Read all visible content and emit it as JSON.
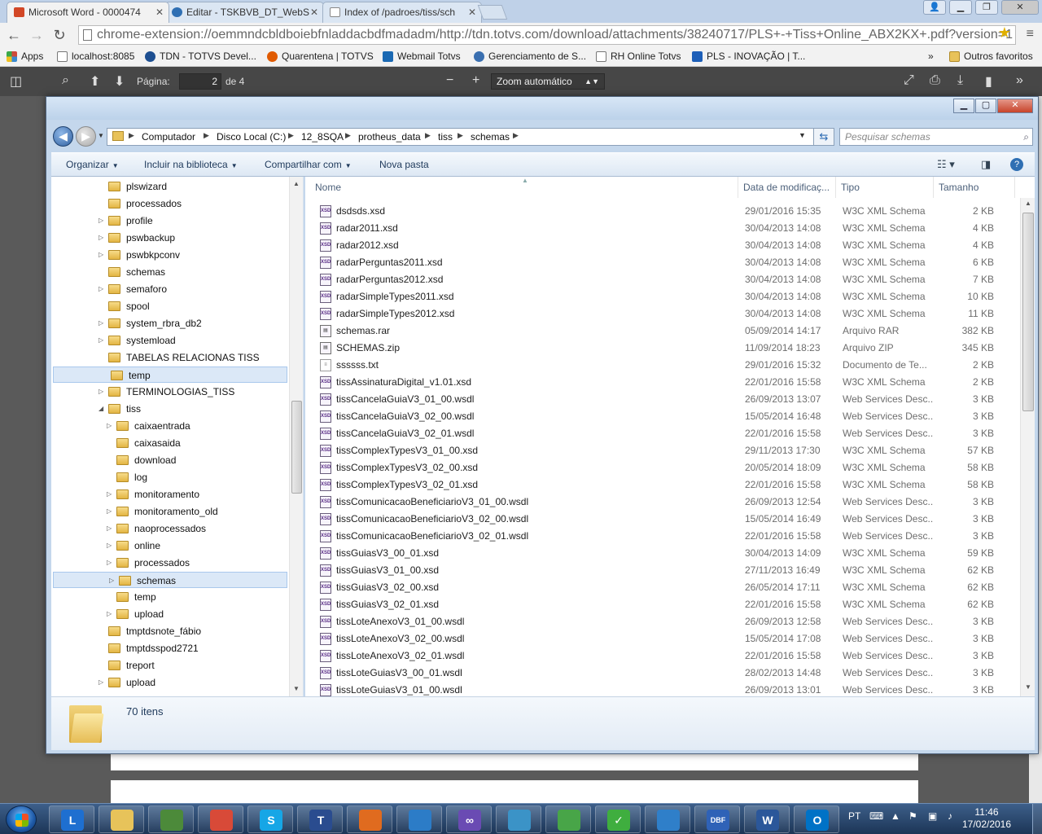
{
  "browser": {
    "tabs": [
      {
        "label": "Microsoft Word - 0000474",
        "icon": "office-icon",
        "color": "#d24726",
        "active": true
      },
      {
        "label": "Editar - TSKBVB_DT_WebS",
        "icon": "confluence-icon",
        "color": "#2f6fb3",
        "active": false
      },
      {
        "label": "Index of /padroes/tiss/sch",
        "icon": "page-icon",
        "color": "#9a9a9a",
        "active": false
      }
    ],
    "url": "chrome-extension://oemmndcbldboiebfnladdacbdfmadadm/http://tdn.totvs.com/download/attachments/38240717/PLS+-+Tiss+Online_ABX2KX+.pdf?version=1",
    "bookmarks": [
      {
        "label": "Apps",
        "icon": "apps-icon",
        "color": "#d04a3a"
      },
      {
        "label": "localhost:8085",
        "icon": "page-icon",
        "color": "#ffffff"
      },
      {
        "label": "TDN - TOTVS Devel...",
        "icon": "totvs-icon",
        "color": "#1d4f91"
      },
      {
        "label": "Quarentena | TOTVS",
        "icon": "totvs-icon",
        "color": "#e05a00"
      },
      {
        "label": "Webmail Totvs",
        "icon": "mail-icon",
        "color": "#1b69b3"
      },
      {
        "label": "Gerenciamento de S...",
        "icon": "globe-icon",
        "color": "#3a6fb0"
      },
      {
        "label": "RH Online Totvs",
        "icon": "page-icon",
        "color": "#ffffff"
      },
      {
        "label": "PLS - INOVAÇÃO | T...",
        "icon": "jira-icon",
        "color": "#1d5fb8"
      }
    ],
    "bookmarks_overflow": "»",
    "other_bookmarks": "Outros favoritos"
  },
  "pdf_toolbar": {
    "page_label": "Página:",
    "page_value": "2",
    "page_total": "de 4",
    "zoom": "Zoom automático",
    "zoom_out": "−",
    "zoom_in": "+"
  },
  "explorer": {
    "breadcrumb": [
      "Computador",
      "Disco Local (C:)",
      "12_8SQA",
      "protheus_data",
      "tiss",
      "schemas"
    ],
    "search_placeholder": "Pesquisar schemas",
    "commands": {
      "organize": "Organizar",
      "include": "Incluir na biblioteca",
      "share": "Compartilhar com",
      "new_folder": "Nova pasta"
    },
    "nav_tree": [
      {
        "label": "plswizard",
        "level": 0,
        "expandable": false,
        "selected": false
      },
      {
        "label": "processados",
        "level": 0,
        "expandable": false,
        "selected": false
      },
      {
        "label": "profile",
        "level": 0,
        "expandable": true,
        "selected": false
      },
      {
        "label": "pswbackup",
        "level": 0,
        "expandable": true,
        "selected": false
      },
      {
        "label": "pswbkpconv",
        "level": 0,
        "expandable": true,
        "selected": false
      },
      {
        "label": "schemas",
        "level": 0,
        "expandable": false,
        "selected": false
      },
      {
        "label": "semaforo",
        "level": 0,
        "expandable": true,
        "selected": false
      },
      {
        "label": "spool",
        "level": 0,
        "expandable": false,
        "selected": false
      },
      {
        "label": "system_rbra_db2",
        "level": 0,
        "expandable": true,
        "selected": false
      },
      {
        "label": "systemload",
        "level": 0,
        "expandable": true,
        "selected": false
      },
      {
        "label": "TABELAS RELACIONAS TISS",
        "level": 0,
        "expandable": false,
        "selected": false
      },
      {
        "label": "temp",
        "level": 0,
        "expandable": false,
        "selected": true
      },
      {
        "label": "TERMINOLOGIAS_TISS",
        "level": 0,
        "expandable": true,
        "selected": false
      },
      {
        "label": "tiss",
        "level": 0,
        "expandable": true,
        "expanded": true,
        "selected": false
      },
      {
        "label": "caixaentrada",
        "level": 1,
        "expandable": true,
        "selected": false
      },
      {
        "label": "caixasaida",
        "level": 1,
        "expandable": false,
        "selected": false
      },
      {
        "label": "download",
        "level": 1,
        "expandable": false,
        "selected": false
      },
      {
        "label": "log",
        "level": 1,
        "expandable": false,
        "selected": false
      },
      {
        "label": "monitoramento",
        "level": 1,
        "expandable": true,
        "selected": false
      },
      {
        "label": "monitoramento_old",
        "level": 1,
        "expandable": true,
        "selected": false
      },
      {
        "label": "naoprocessados",
        "level": 1,
        "expandable": true,
        "selected": false
      },
      {
        "label": "online",
        "level": 1,
        "expandable": true,
        "selected": false
      },
      {
        "label": "processados",
        "level": 1,
        "expandable": true,
        "selected": false
      },
      {
        "label": "schemas",
        "level": 1,
        "expandable": true,
        "selected": true
      },
      {
        "label": "temp",
        "level": 1,
        "expandable": false,
        "selected": false
      },
      {
        "label": "upload",
        "level": 1,
        "expandable": true,
        "selected": false
      },
      {
        "label": "tmptdsnote_fábio",
        "level": 0,
        "expandable": false,
        "selected": false
      },
      {
        "label": "tmptdsspod2721",
        "level": 0,
        "expandable": false,
        "selected": false
      },
      {
        "label": "treport",
        "level": 0,
        "expandable": false,
        "selected": false
      },
      {
        "label": "upload",
        "level": 0,
        "expandable": true,
        "selected": false
      }
    ],
    "columns": {
      "name": "Nome",
      "modified": "Data de modificaç...",
      "type": "Tipo",
      "size": "Tamanho"
    },
    "files": [
      {
        "name": "dsdsds.xsd",
        "modified": "29/01/2016 15:35",
        "type": "W3C XML Schema",
        "size": "2 KB",
        "icon": "xsd"
      },
      {
        "name": "radar2011.xsd",
        "modified": "30/04/2013 14:08",
        "type": "W3C XML Schema",
        "size": "4 KB",
        "icon": "xsd"
      },
      {
        "name": "radar2012.xsd",
        "modified": "30/04/2013 14:08",
        "type": "W3C XML Schema",
        "size": "4 KB",
        "icon": "xsd"
      },
      {
        "name": "radarPerguntas2011.xsd",
        "modified": "30/04/2013 14:08",
        "type": "W3C XML Schema",
        "size": "6 KB",
        "icon": "xsd"
      },
      {
        "name": "radarPerguntas2012.xsd",
        "modified": "30/04/2013 14:08",
        "type": "W3C XML Schema",
        "size": "7 KB",
        "icon": "xsd"
      },
      {
        "name": "radarSimpleTypes2011.xsd",
        "modified": "30/04/2013 14:08",
        "type": "W3C XML Schema",
        "size": "10 KB",
        "icon": "xsd"
      },
      {
        "name": "radarSimpleTypes2012.xsd",
        "modified": "30/04/2013 14:08",
        "type": "W3C XML Schema",
        "size": "11 KB",
        "icon": "xsd"
      },
      {
        "name": "schemas.rar",
        "modified": "05/09/2014 14:17",
        "type": "Arquivo RAR",
        "size": "382 KB",
        "icon": "rar"
      },
      {
        "name": "SCHEMAS.zip",
        "modified": "11/09/2014 18:23",
        "type": "Arquivo ZIP",
        "size": "345 KB",
        "icon": "rar"
      },
      {
        "name": "ssssss.txt",
        "modified": "29/01/2016 15:32",
        "type": "Documento de Te...",
        "size": "2 KB",
        "icon": "txt"
      },
      {
        "name": "tissAssinaturaDigital_v1.01.xsd",
        "modified": "22/01/2016 15:58",
        "type": "W3C XML Schema",
        "size": "2 KB",
        "icon": "xsd"
      },
      {
        "name": "tissCancelaGuiaV3_01_00.wsdl",
        "modified": "26/09/2013 13:07",
        "type": "Web Services Desc...",
        "size": "3 KB",
        "icon": "xsd"
      },
      {
        "name": "tissCancelaGuiaV3_02_00.wsdl",
        "modified": "15/05/2014 16:48",
        "type": "Web Services Desc...",
        "size": "3 KB",
        "icon": "xsd"
      },
      {
        "name": "tissCancelaGuiaV3_02_01.wsdl",
        "modified": "22/01/2016 15:58",
        "type": "Web Services Desc...",
        "size": "3 KB",
        "icon": "xsd"
      },
      {
        "name": "tissComplexTypesV3_01_00.xsd",
        "modified": "29/11/2013 17:30",
        "type": "W3C XML Schema",
        "size": "57 KB",
        "icon": "xsd"
      },
      {
        "name": "tissComplexTypesV3_02_00.xsd",
        "modified": "20/05/2014 18:09",
        "type": "W3C XML Schema",
        "size": "58 KB",
        "icon": "xsd"
      },
      {
        "name": "tissComplexTypesV3_02_01.xsd",
        "modified": "22/01/2016 15:58",
        "type": "W3C XML Schema",
        "size": "58 KB",
        "icon": "xsd"
      },
      {
        "name": "tissComunicacaoBeneficiarioV3_01_00.wsdl",
        "modified": "26/09/2013 12:54",
        "type": "Web Services Desc...",
        "size": "3 KB",
        "icon": "xsd"
      },
      {
        "name": "tissComunicacaoBeneficiarioV3_02_00.wsdl",
        "modified": "15/05/2014 16:49",
        "type": "Web Services Desc...",
        "size": "3 KB",
        "icon": "xsd"
      },
      {
        "name": "tissComunicacaoBeneficiarioV3_02_01.wsdl",
        "modified": "22/01/2016 15:58",
        "type": "Web Services Desc...",
        "size": "3 KB",
        "icon": "xsd"
      },
      {
        "name": "tissGuiasV3_00_01.xsd",
        "modified": "30/04/2013 14:09",
        "type": "W3C XML Schema",
        "size": "59 KB",
        "icon": "xsd"
      },
      {
        "name": "tissGuiasV3_01_00.xsd",
        "modified": "27/11/2013 16:49",
        "type": "W3C XML Schema",
        "size": "62 KB",
        "icon": "xsd"
      },
      {
        "name": "tissGuiasV3_02_00.xsd",
        "modified": "26/05/2014 17:11",
        "type": "W3C XML Schema",
        "size": "62 KB",
        "icon": "xsd"
      },
      {
        "name": "tissGuiasV3_02_01.xsd",
        "modified": "22/01/2016 15:58",
        "type": "W3C XML Schema",
        "size": "62 KB",
        "icon": "xsd"
      },
      {
        "name": "tissLoteAnexoV3_01_00.wsdl",
        "modified": "26/09/2013 12:58",
        "type": "Web Services Desc...",
        "size": "3 KB",
        "icon": "xsd"
      },
      {
        "name": "tissLoteAnexoV3_02_00.wsdl",
        "modified": "15/05/2014 17:08",
        "type": "Web Services Desc...",
        "size": "3 KB",
        "icon": "xsd"
      },
      {
        "name": "tissLoteAnexoV3_02_01.wsdl",
        "modified": "22/01/2016 15:58",
        "type": "Web Services Desc...",
        "size": "3 KB",
        "icon": "xsd"
      },
      {
        "name": "tissLoteGuiasV3_00_01.wsdl",
        "modified": "28/02/2013 14:48",
        "type": "Web Services Desc...",
        "size": "3 KB",
        "icon": "xsd"
      },
      {
        "name": "tissLoteGuiasV3_01_00.wsdl",
        "modified": "26/09/2013 13:01",
        "type": "Web Services Desc...",
        "size": "3 KB",
        "icon": "xsd"
      }
    ],
    "item_count": "70 itens"
  },
  "taskbar": {
    "apps": [
      {
        "name": "lync-app",
        "glyph": "L",
        "color": "#1e6fd0"
      },
      {
        "name": "explorer-app",
        "glyph": "",
        "color": "#e7c35a"
      },
      {
        "name": "remote-app",
        "glyph": "",
        "color": "#4c8a3a"
      },
      {
        "name": "chrome-app",
        "glyph": "",
        "color": "#d84a38"
      },
      {
        "name": "skype-app",
        "glyph": "S",
        "color": "#16a6e6"
      },
      {
        "name": "totvs-app",
        "glyph": "T",
        "color": "#2a4c8f"
      },
      {
        "name": "media-app",
        "glyph": "",
        "color": "#e06b1f"
      },
      {
        "name": "ide-app",
        "glyph": "",
        "color": "#2c7cc7"
      },
      {
        "name": "vs-app",
        "glyph": "∞",
        "color": "#6a4bb3"
      },
      {
        "name": "monitor-app",
        "glyph": "",
        "color": "#3b93c7"
      },
      {
        "name": "sync-app",
        "glyph": "",
        "color": "#48a548"
      },
      {
        "name": "check-app",
        "glyph": "✓",
        "color": "#3fae3f"
      },
      {
        "name": "dev-app",
        "glyph": "",
        "color": "#2f7fc9"
      },
      {
        "name": "dbf-app",
        "glyph": "DBF",
        "color": "#2f62b7"
      },
      {
        "name": "word-app",
        "glyph": "W",
        "color": "#2b579a"
      },
      {
        "name": "outlook-app",
        "glyph": "O",
        "color": "#0072c6"
      }
    ],
    "lang": "PT",
    "time": "11:46",
    "date": "17/02/2016"
  }
}
